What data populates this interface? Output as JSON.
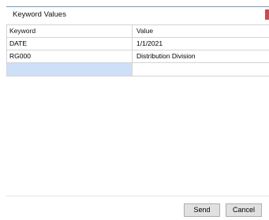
{
  "window": {
    "title": "Keyword Values"
  },
  "grid": {
    "columns": [
      "Keyword",
      "Value"
    ],
    "rows": [
      [
        "DATE",
        "1/1/2021"
      ],
      [
        "RG000",
        "Distribution Division"
      ]
    ],
    "new_row": [
      "",
      ""
    ]
  },
  "footer": {
    "send_label": "Send",
    "cancel_label": "Cancel"
  },
  "colors": {
    "accent": "#6e98b8",
    "close_accent": "#c0504d",
    "new_row_highlight": "#cde0f7"
  }
}
